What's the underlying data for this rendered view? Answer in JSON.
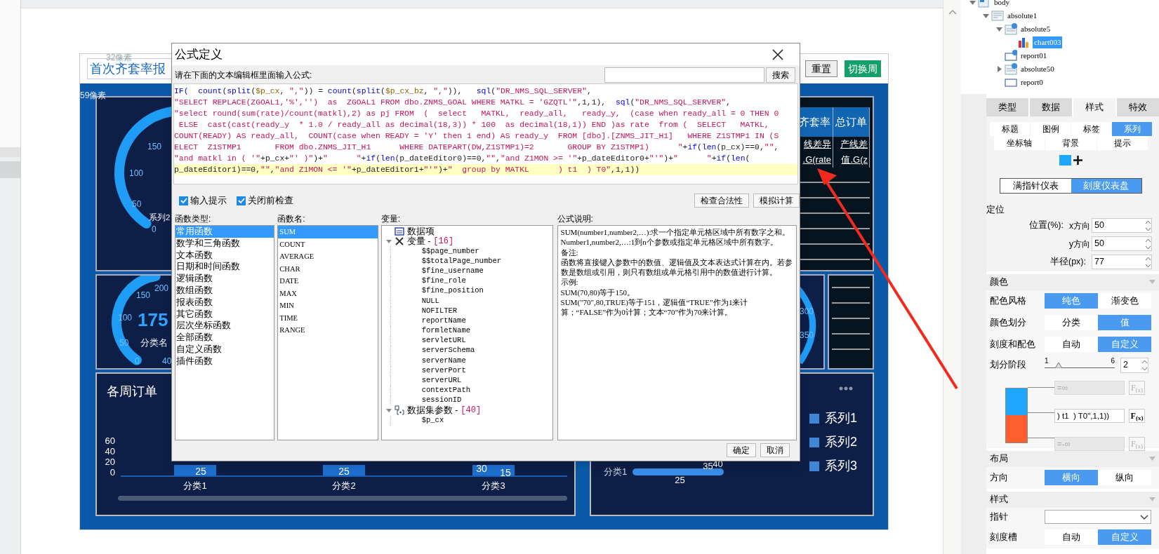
{
  "canvas": {
    "ruler_hints": [
      "32像素",
      "59像素"
    ]
  },
  "report": {
    "title": "首次齐套率报",
    "buttons": [
      {
        "label": "重置",
        "kind": "plain"
      },
      {
        "label": "切换周",
        "kind": "accent"
      }
    ],
    "gauge_top": {
      "ticks": [
        "150",
        "100",
        "50",
        "0"
      ],
      "labels": [
        "系列2"
      ]
    },
    "gauge_middle": {
      "ticks": [
        "150",
        "200",
        "100",
        "50",
        "0",
        "40"
      ],
      "value": "175",
      "labels": [
        "分类名"
      ]
    },
    "gauge_right": {
      "ticks": [
        "300",
        "350"
      ]
    },
    "table": {
      "columns": [
        "齐套率",
        "总订单"
      ],
      "rows": [
        [
          "线差异",
          "产线差"
        ],
        [
          ".G(rate",
          "值.G(z"
        ]
      ]
    },
    "bar_panel": {
      "title": "各周订单",
      "yticks": [
        "60",
        "40",
        "20",
        "0"
      ],
      "categories": [
        "分类1",
        "分类2",
        "分类3"
      ],
      "bar_labels": [
        "25",
        "25",
        "30",
        "15"
      ]
    },
    "legend_panel": {
      "legend": [
        "系列1",
        "系列2",
        "系列3"
      ],
      "category": "分类1",
      "bar_labels": [
        "25",
        "35",
        "40"
      ]
    }
  },
  "dialog": {
    "title": "公式定义",
    "prompt": "请在下面的文本编辑框里面输入公式:",
    "search_button": "搜索",
    "formula_lines": [
      {
        "highlighted": false,
        "tokens": [
          {
            "kind": "f",
            "text": "IF(  "
          },
          {
            "kind": "f",
            "text": "count"
          },
          {
            "kind": "p",
            "text": "("
          },
          {
            "kind": "f",
            "text": "split"
          },
          {
            "kind": "p",
            "text": "("
          },
          {
            "kind": "v",
            "text": "$p_cx"
          },
          {
            "kind": "p",
            "text": ", "
          },
          {
            "kind": "s",
            "text": "\",\""
          },
          {
            "kind": "p",
            "text": ")) = "
          },
          {
            "kind": "f",
            "text": "count"
          },
          {
            "kind": "p",
            "text": "("
          },
          {
            "kind": "f",
            "text": "split"
          },
          {
            "kind": "p",
            "text": "("
          },
          {
            "kind": "v",
            "text": "$p_cx_bz"
          },
          {
            "kind": "p",
            "text": ", "
          },
          {
            "kind": "s",
            "text": "\",\""
          },
          {
            "kind": "p",
            "text": ")),   "
          },
          {
            "kind": "f",
            "text": "sql"
          },
          {
            "kind": "p",
            "text": "("
          },
          {
            "kind": "s",
            "text": "\"DR_NMS_SQL_SERVER\""
          },
          {
            "kind": "p",
            "text": ","
          }
        ]
      },
      {
        "highlighted": false,
        "tokens": [
          {
            "kind": "s",
            "text": "\"SELECT REPLACE(ZGOAL1,'%','')  as  ZGOAL1 FROM dbo.ZNMS_GOAL WHERE MATKL = 'GZQTL'\""
          },
          {
            "kind": "p",
            "text": ",1,1),  "
          },
          {
            "kind": "f",
            "text": "sql"
          },
          {
            "kind": "p",
            "text": "("
          },
          {
            "kind": "s",
            "text": "\"DR_NMS_SQL_SERVER\""
          },
          {
            "kind": "p",
            "text": ","
          }
        ]
      },
      {
        "highlighted": false,
        "tokens": [
          {
            "kind": "s",
            "text": "\"select round(sum(rate)/count(matkl),2) as pj FROM  (  select   MATKL,  ready_all,   ready_y,  (case when ready_all = 0 THEN 0"
          }
        ]
      },
      {
        "highlighted": false,
        "tokens": [
          {
            "kind": "s",
            "text": " ELSE  cast(cast(ready_y  * 1.0 / ready_all as decimal(18,3)) * 100  as decimal(18,1)) END )as rate  from (  SELECT   MATKL,"
          }
        ]
      },
      {
        "highlighted": false,
        "tokens": [
          {
            "kind": "s",
            "text": "COUNT(READY) AS ready_all,  COUNT(case when READY = 'Y' then 1 end) AS ready_y  FROM [dbo].[ZNMS_JIT_H1]   WHERE Z1STMP1 IN (S"
          }
        ]
      },
      {
        "highlighted": false,
        "tokens": [
          {
            "kind": "s",
            "text": "ELECT  Z1STMP1       FROM dbo.ZNMS_JIT_H1      WHERE DATEPART(DW,Z1STMP1)=2       GROUP BY Z1STMP1)      \""
          },
          {
            "kind": "p",
            "text": "+"
          },
          {
            "kind": "f",
            "text": "if"
          },
          {
            "kind": "p",
            "text": "("
          },
          {
            "kind": "f",
            "text": "len"
          },
          {
            "kind": "p",
            "text": "(p_cx)==0,"
          },
          {
            "kind": "s",
            "text": "\"\""
          },
          {
            "kind": "p",
            "text": ","
          }
        ]
      },
      {
        "highlighted": false,
        "tokens": [
          {
            "kind": "s",
            "text": "\"and matkl in ( '\""
          },
          {
            "kind": "p",
            "text": "+p_cx+"
          },
          {
            "kind": "s",
            "text": "\"' )\""
          },
          {
            "kind": "p",
            "text": ")+"
          },
          {
            "kind": "s",
            "text": "\"      \""
          },
          {
            "kind": "p",
            "text": "+"
          },
          {
            "kind": "f",
            "text": "if"
          },
          {
            "kind": "p",
            "text": "("
          },
          {
            "kind": "f",
            "text": "len"
          },
          {
            "kind": "p",
            "text": "(p_dateEditor0)==0,"
          },
          {
            "kind": "s",
            "text": "\"\""
          },
          {
            "kind": "p",
            "text": ","
          },
          {
            "kind": "s",
            "text": "\"and Z1MON >= '\""
          },
          {
            "kind": "p",
            "text": "+p_dateEditor0+"
          },
          {
            "kind": "s",
            "text": "\"'\""
          },
          {
            "kind": "p",
            "text": ")+"
          },
          {
            "kind": "s",
            "text": "\"      \""
          },
          {
            "kind": "p",
            "text": "+"
          },
          {
            "kind": "f",
            "text": "if"
          },
          {
            "kind": "p",
            "text": "("
          },
          {
            "kind": "f",
            "text": "len"
          },
          {
            "kind": "p",
            "text": "("
          }
        ]
      },
      {
        "highlighted": true,
        "tokens": [
          {
            "kind": "p",
            "text": "p_dateEditor1)==0,"
          },
          {
            "kind": "s",
            "text": "\"\""
          },
          {
            "kind": "p",
            "text": ","
          },
          {
            "kind": "s",
            "text": "\"and Z1MON <= '\""
          },
          {
            "kind": "p",
            "text": "+p_dateEditor1+"
          },
          {
            "kind": "s",
            "text": "\"'\""
          },
          {
            "kind": "p",
            "text": ")+"
          },
          {
            "kind": "s",
            "text": "\"  group by MATKL      ) t1  ) T0\""
          },
          {
            "kind": "p",
            "text": ",1,1))"
          }
        ]
      }
    ],
    "options": [
      {
        "label": "输入提示",
        "checked": true
      },
      {
        "label": "关闭前检查",
        "checked": true
      }
    ],
    "tool_buttons": [
      "检查合法性",
      "模拟计算"
    ],
    "function_types": {
      "header": "函数类型:",
      "items": [
        {
          "label": "常用函数",
          "selected": true
        },
        {
          "label": "数学和三角函数",
          "selected": false
        },
        {
          "label": "文本函数",
          "selected": false
        },
        {
          "label": "日期和时间函数",
          "selected": false
        },
        {
          "label": "逻辑函数",
          "selected": false
        },
        {
          "label": "数组函数",
          "selected": false
        },
        {
          "label": "报表函数",
          "selected": false
        },
        {
          "label": "其它函数",
          "selected": false
        },
        {
          "label": "层次坐标函数",
          "selected": false
        },
        {
          "label": "全部函数",
          "selected": false
        },
        {
          "label": "自定义函数",
          "selected": false
        },
        {
          "label": "插件函数",
          "selected": false
        }
      ]
    },
    "function_names": {
      "header": "函数名:",
      "items": [
        {
          "label": "SUM",
          "selected": true
        },
        {
          "label": "COUNT",
          "selected": false
        },
        {
          "label": "AVERAGE",
          "selected": false
        },
        {
          "label": "CHAR",
          "selected": false
        },
        {
          "label": "DATE",
          "selected": false
        },
        {
          "label": "MAX",
          "selected": false
        },
        {
          "label": "MIN",
          "selected": false
        },
        {
          "label": "TIME",
          "selected": false
        },
        {
          "label": "RANGE",
          "selected": false
        }
      ]
    },
    "variables": {
      "header": "变量:",
      "tree": [
        {
          "label": "数据项",
          "kind": "item"
        },
        {
          "label": "变量 -",
          "count": "[16]",
          "kind": "variables",
          "expanded": true,
          "children": [
            {
              "label": "$$page_number"
            },
            {
              "label": "$$totalPage_number"
            },
            {
              "label": "$fine_username"
            },
            {
              "label": "$fine_role"
            },
            {
              "label": "$fine_position"
            },
            {
              "label": "NULL"
            },
            {
              "label": "NOFILTER"
            },
            {
              "label": "reportName"
            },
            {
              "label": "formletName"
            },
            {
              "label": "servletURL"
            },
            {
              "label": "serverSchema"
            },
            {
              "label": "serverName"
            },
            {
              "label": "serverPort"
            },
            {
              "label": "serverURL"
            },
            {
              "label": "contextPath"
            },
            {
              "label": "sessionID"
            }
          ]
        },
        {
          "label": "数据集参数 -",
          "count": "[40]",
          "kind": "parameters",
          "expanded": true,
          "children": [
            {
              "label": "$p_cx"
            }
          ]
        }
      ]
    },
    "description": {
      "header": "公式说明:",
      "paragraphs": [
        "SUM(number1,number2,…):求一个指定单元格区域中所有数字之和。",
        "Number1,number2,…:1到n个参数或指定单元格区域中所有数字。",
        "备注:",
        "函数将直接键入参数中的数值、逻辑值及文本表达式计算在内。若参数是数组或引用，则只有数组或单元格引用中的数值进行计算。",
        "示例:",
        "SUM(70,80)等于150。",
        "SUM(\"70\",80,TRUE)等于151，逻辑值“TRUE”作为1来计算；“FALSE”作为0计算；文本“70”作为70来计算。"
      ]
    },
    "footer_buttons": [
      "确定",
      "取消"
    ]
  },
  "right_panel": {
    "structure_tree": [
      {
        "label": "body",
        "kind": "body",
        "expanded": true,
        "selected": false,
        "children": [
          {
            "label": "absolute1",
            "kind": "absolute",
            "expanded": true,
            "selected": false,
            "children": [
              {
                "label": "absolute5",
                "kind": "absolute_linked",
                "expanded": true,
                "selected": false,
                "children": [
                  {
                    "label": "chart003",
                    "kind": "chart",
                    "selected": true
                  }
                ]
              },
              {
                "label": "report01",
                "kind": "report_linked",
                "selected": false
              },
              {
                "label": "absolute50",
                "kind": "absolute_linked",
                "expanded": false,
                "selected": false
              },
              {
                "label": "report0",
                "kind": "report",
                "selected": false
              }
            ]
          }
        ]
      }
    ],
    "tabs": [
      {
        "label": "类型",
        "selected": false
      },
      {
        "label": "数据",
        "selected": false
      },
      {
        "label": "样式",
        "selected": true
      },
      {
        "label": "特效",
        "selected": false
      }
    ],
    "sub_tabs": [
      [
        {
          "label": "标题",
          "selected": false
        },
        {
          "label": "图例",
          "selected": false
        },
        {
          "label": "标签",
          "selected": false
        },
        {
          "label": "系列",
          "selected": true
        }
      ],
      [
        {
          "label": "坐标轴",
          "selected": false
        },
        {
          "label": "背景",
          "selected": false
        },
        {
          "label": "提示",
          "selected": false
        }
      ]
    ],
    "gauge_types": [
      {
        "label": "满指针仪表",
        "selected": false
      },
      {
        "label": "刻度仪表盘",
        "selected": true
      }
    ],
    "positioning": {
      "title": "定位",
      "fields": [
        {
          "group": "位置(%):",
          "label": "x方向",
          "value": "50"
        },
        {
          "label": "y方向",
          "value": "50"
        },
        {
          "group": "半径(px):",
          "value": "77"
        }
      ]
    },
    "color_section": {
      "title": "颜色",
      "rows": [
        {
          "label": "配色风格",
          "options": [
            {
              "label": "纯色",
              "selected": true
            },
            {
              "label": "渐变色",
              "selected": false
            }
          ]
        },
        {
          "label": "颜色划分",
          "options": [
            {
              "label": "分类",
              "selected": false
            },
            {
              "label": "值",
              "selected": true
            }
          ]
        },
        {
          "label": "刻度和配色",
          "options": [
            {
              "label": "自动",
              "selected": false
            },
            {
              "label": "自定义",
              "selected": true
            }
          ]
        }
      ],
      "stages": {
        "label": "划分阶段",
        "min": "1",
        "max": "6",
        "level": 0.2,
        "value": "2"
      },
      "stage_colors": [
        {
          "color": "#1ea7fd"
        },
        {
          "color": "#ff5f2e"
        }
      ],
      "stage_bounds": [
        {
          "placeholder": "=∞",
          "disabled": true,
          "fx": "F$_{(x)}$"
        },
        {
          "value": ") t1  ) T0\",1,1))",
          "disabled": false,
          "fx": "F$_{(x)}$"
        },
        {
          "placeholder": "=-∞",
          "disabled": true,
          "fx": "F$_{(x)}$"
        }
      ]
    },
    "layout_section": {
      "title": "布局",
      "rows": [
        {
          "label": "方向",
          "options": [
            {
              "label": "横向",
              "selected": true
            },
            {
              "label": "纵向",
              "selected": false
            }
          ]
        }
      ]
    },
    "style_section": {
      "title": "样式",
      "pointer_label": "指针",
      "rows": [
        {
          "label": "刻度槽",
          "options": [
            {
              "label": "自动",
              "selected": false
            },
            {
              "label": "自定义",
              "selected": true
            }
          ]
        }
      ]
    }
  }
}
